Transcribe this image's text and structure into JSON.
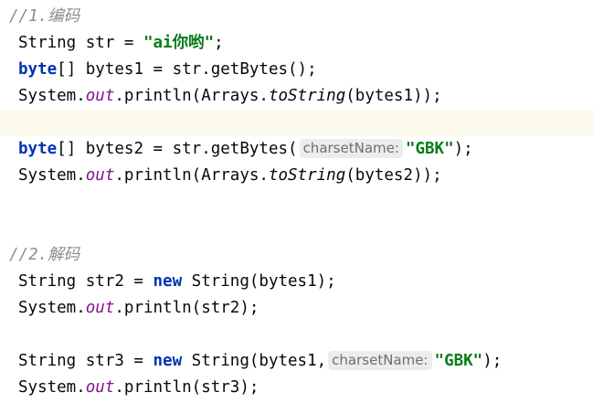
{
  "editor": {
    "lines": [
      {
        "tokens": [
          {
            "t": "//1.",
            "c": "comment"
          },
          {
            "t": "编码",
            "c": "comment cjk"
          }
        ]
      },
      {
        "tokens": [
          {
            "t": "String str = ",
            "c": ""
          },
          {
            "t": "\"ai",
            "c": "str"
          },
          {
            "t": "你哟",
            "c": "str cjk"
          },
          {
            "t": "\"",
            "c": "str"
          },
          {
            "t": ";",
            "c": ""
          }
        ]
      },
      {
        "tokens": [
          {
            "t": "byte",
            "c": "kw"
          },
          {
            "t": "[] bytes1 = str.getBytes();",
            "c": ""
          }
        ]
      },
      {
        "tokens": [
          {
            "t": "System.",
            "c": ""
          },
          {
            "t": "out",
            "c": "field"
          },
          {
            "t": ".println(Arrays.",
            "c": ""
          },
          {
            "t": "toString",
            "c": "static"
          },
          {
            "t": "(bytes1));",
            "c": ""
          }
        ]
      },
      {
        "tokens": []
      },
      {
        "tokens": [
          {
            "t": "byte",
            "c": "kw"
          },
          {
            "t": "[] bytes2 = str.getBytes(",
            "c": ""
          },
          {
            "t": "charsetName:",
            "c": "hint"
          },
          {
            "t": "\"GBK\"",
            "c": "str"
          },
          {
            "t": ");",
            "c": ""
          }
        ]
      },
      {
        "tokens": [
          {
            "t": "System.",
            "c": ""
          },
          {
            "t": "out",
            "c": "field"
          },
          {
            "t": ".println(Arrays.",
            "c": ""
          },
          {
            "t": "toString",
            "c": "static"
          },
          {
            "t": "(bytes2));",
            "c": ""
          }
        ]
      },
      {
        "tokens": []
      },
      {
        "tokens": []
      },
      {
        "tokens": [
          {
            "t": "//2.",
            "c": "comment"
          },
          {
            "t": "解码",
            "c": "comment cjk"
          }
        ]
      },
      {
        "tokens": [
          {
            "t": "String str2 = ",
            "c": ""
          },
          {
            "t": "new",
            "c": "kw"
          },
          {
            "t": " String(bytes1);",
            "c": ""
          }
        ]
      },
      {
        "tokens": [
          {
            "t": "System.",
            "c": ""
          },
          {
            "t": "out",
            "c": "field"
          },
          {
            "t": ".println(str2);",
            "c": ""
          }
        ]
      },
      {
        "tokens": []
      },
      {
        "tokens": [
          {
            "t": "String str3 = ",
            "c": ""
          },
          {
            "t": "new",
            "c": "kw"
          },
          {
            "t": " String(bytes1,",
            "c": ""
          },
          {
            "t": "charsetName:",
            "c": "hint"
          },
          {
            "t": "\"GBK\"",
            "c": "str"
          },
          {
            "t": ");",
            "c": ""
          }
        ]
      },
      {
        "tokens": [
          {
            "t": "System.",
            "c": ""
          },
          {
            "t": "out",
            "c": "field"
          },
          {
            "t": ".println(str3);",
            "c": ""
          }
        ]
      }
    ]
  }
}
